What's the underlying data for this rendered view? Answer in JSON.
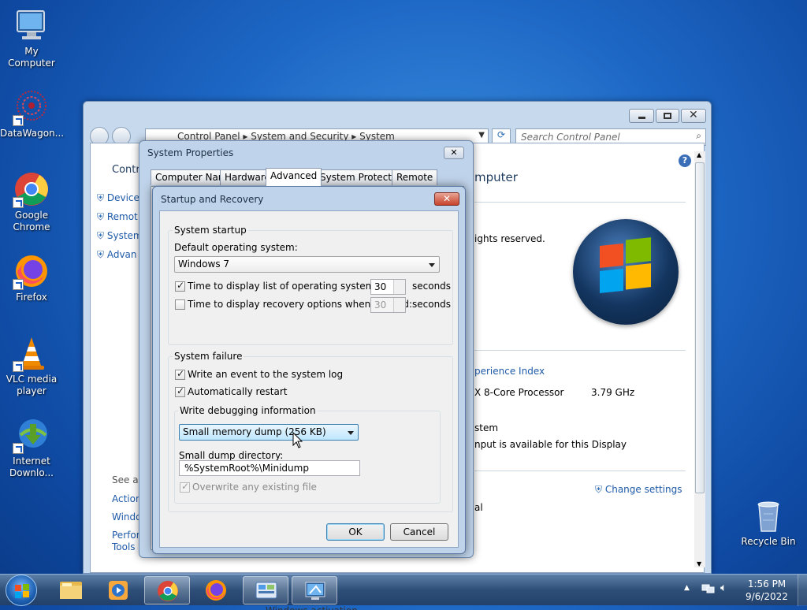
{
  "desktop": {
    "icons": [
      {
        "label": "My Computer"
      },
      {
        "label": "DataWagon..."
      },
      {
        "label": "Google Chrome"
      },
      {
        "label": "Firefox"
      },
      {
        "label": "VLC media player"
      },
      {
        "label": "Internet Downlo..."
      },
      {
        "label": "Recycle Bin"
      }
    ]
  },
  "control_panel": {
    "breadcrumb": [
      "Control Panel",
      "System and Security",
      "System"
    ],
    "search_placeholder": "Search Control Panel",
    "left_title": "Control",
    "left_links": [
      "Device",
      "Remot",
      "System",
      "Advan"
    ],
    "see_also": "See als",
    "see_also_links": [
      "Action",
      "Windows",
      "Perform Tools"
    ],
    "heading": "mputer",
    "rights": "ights reserved.",
    "experience_index": "perience Index",
    "processor": "X 8-Core Processor",
    "processor_speed": "3.79 GHz",
    "system_type": "stem",
    "pen_input": "nput is available for this Display",
    "change_settings": "Change settings",
    "partial_al": "al",
    "bottom_cut": "Windows activation"
  },
  "system_properties": {
    "title": "System Properties",
    "tabs": [
      "Computer Name",
      "Hardware",
      "Advanced",
      "System Protection",
      "Remote"
    ],
    "active_tab": "Advanced"
  },
  "startup_recovery": {
    "title": "Startup and Recovery",
    "system_startup": {
      "group_label": "System startup",
      "default_os_label": "Default operating system:",
      "default_os_value": "Windows 7",
      "display_list_label": "Time to display list of operating systems:",
      "display_list_checked": true,
      "display_list_value": "30",
      "recovery_label": "Time to display recovery options when needed:",
      "recovery_checked": false,
      "recovery_value": "30",
      "seconds": "seconds"
    },
    "system_failure": {
      "group_label": "System failure",
      "write_event_label": "Write an event to the system log",
      "write_event_checked": true,
      "auto_restart_label": "Automatically restart",
      "auto_restart_checked": true,
      "debug_group_label": "Write debugging information",
      "debug_value": "Small memory dump (256 KB)",
      "dump_dir_label": "Small dump directory:",
      "dump_dir_value": "%SystemRoot%\\Minidump",
      "overwrite_label": "Overwrite any existing file",
      "overwrite_checked": true
    },
    "ok": "OK",
    "cancel": "Cancel"
  },
  "taskbar": {
    "time": "1:56 PM",
    "date": "9/6/2022"
  }
}
